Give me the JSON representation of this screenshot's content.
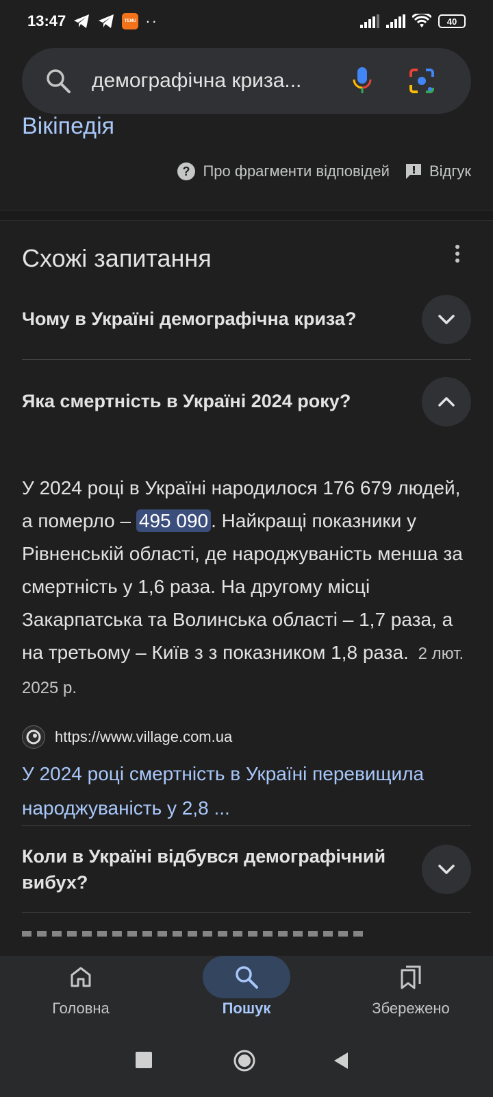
{
  "status_bar": {
    "time": "13:47",
    "battery": "40",
    "app_badge": "TEMU",
    "icons": [
      "telegram-icon",
      "telegram-icon",
      "temu-icon",
      "dots-icon",
      "signal-icon",
      "signal-icon",
      "wifi-icon",
      "battery-icon"
    ]
  },
  "search": {
    "query": "демографічна криза..."
  },
  "snippet": {
    "source_link": "Вікіпедія",
    "about_fragments": "Про фрагменти відповідей",
    "feedback": "Відгук"
  },
  "related": {
    "title": "Схожі запитання",
    "questions": [
      {
        "text": "Чому в Україні демографічна криза?",
        "expanded": false
      },
      {
        "text": "Яка смертність в Україні 2024 року?",
        "expanded": true
      },
      {
        "text": "Коли в Україні відбувся демографічний вибух?",
        "expanded": false
      }
    ],
    "answer": {
      "before": "У 2024 році в Україні народилося 176 679 людей, а померло – ",
      "highlight": "495 090",
      "after": ". Найкращі показники у Рівненській області, де народжуваність менша за смертність у 1,6 раза. На другому місці Закарпатська та Волинська області – 1,7 раза, а на третьому – Київ з з показником 1,8 раза.",
      "date": "2 лют. 2025 р."
    },
    "source": {
      "url": "https://www.village.com.ua",
      "title": "У 2024 році смертність в Україні перевищила народжуваність у 2,8 ..."
    }
  },
  "bottom_nav": {
    "items": [
      {
        "label": "Головна",
        "icon": "home-icon",
        "active": false
      },
      {
        "label": "Пошук",
        "icon": "search-icon",
        "active": true
      },
      {
        "label": "Збережено",
        "icon": "saved-icon",
        "active": false
      }
    ]
  },
  "colors": {
    "background": "#1f1f1f",
    "link": "#a8c7fa",
    "highlight": "#3c4e7b",
    "nav_bg": "#282a2c"
  }
}
